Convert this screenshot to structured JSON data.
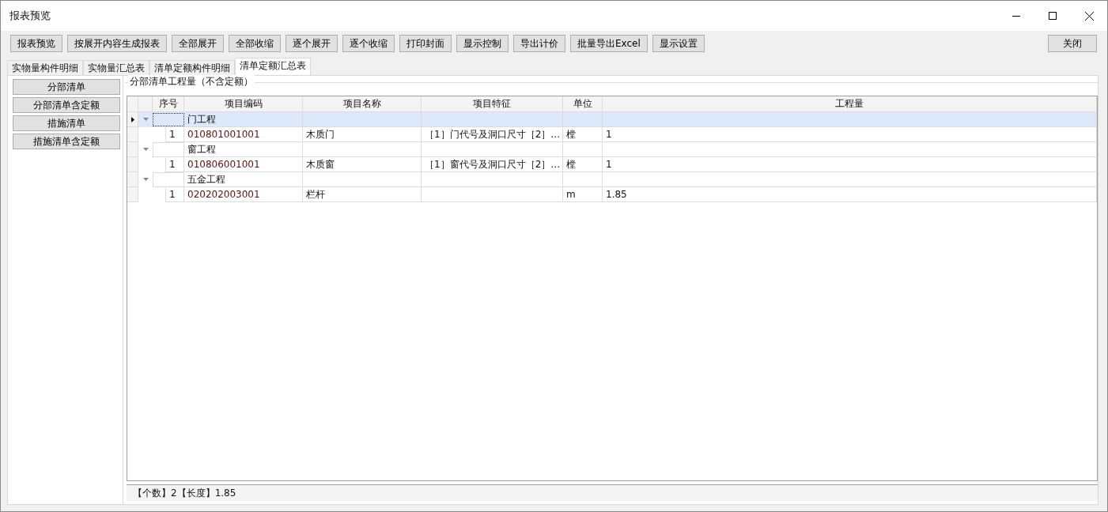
{
  "window": {
    "title": "报表预览"
  },
  "toolbar": {
    "buttons": [
      "报表预览",
      "按展开内容生成报表",
      "全部展开",
      "全部收缩",
      "逐个展开",
      "逐个收缩",
      "打印封面",
      "显示控制",
      "导出计价",
      "批量导出Excel",
      "显示设置"
    ],
    "close_button": "关闭"
  },
  "tabs": [
    {
      "label": "实物量构件明细",
      "selected": false
    },
    {
      "label": "实物量汇总表",
      "selected": false
    },
    {
      "label": "清单定额构件明细",
      "selected": false
    },
    {
      "label": "清单定额汇总表",
      "selected": true
    }
  ],
  "sidebar": {
    "buttons": [
      "分部清单",
      "分部清单含定额",
      "措施清单",
      "措施清单含定额"
    ]
  },
  "group_box": {
    "title": "分部清单工程量（不含定额）"
  },
  "table": {
    "columns": [
      "序号",
      "项目编码",
      "项目名称",
      "项目特征",
      "单位",
      "工程量"
    ],
    "groups": [
      {
        "name": "门工程",
        "expanded": true,
        "selected": true,
        "children": [
          {
            "index": "1",
            "code": "010801001001",
            "name": "木质门",
            "feature": "［1］门代号及洞口尺寸［2］…",
            "unit": "樘",
            "quantity": "1"
          }
        ]
      },
      {
        "name": "窗工程",
        "expanded": true,
        "selected": false,
        "children": [
          {
            "index": "1",
            "code": "010806001001",
            "name": "木质窗",
            "feature": "［1］窗代号及洞口尺寸［2］…",
            "unit": "樘",
            "quantity": "1"
          }
        ]
      },
      {
        "name": "五金工程",
        "expanded": true,
        "selected": false,
        "children": [
          {
            "index": "1",
            "code": "020202003001",
            "name": "栏杆",
            "unit": "m",
            "quantity": "1.85"
          }
        ]
      }
    ]
  },
  "status_bar": {
    "text": "【个数】2【长度】1.85"
  }
}
